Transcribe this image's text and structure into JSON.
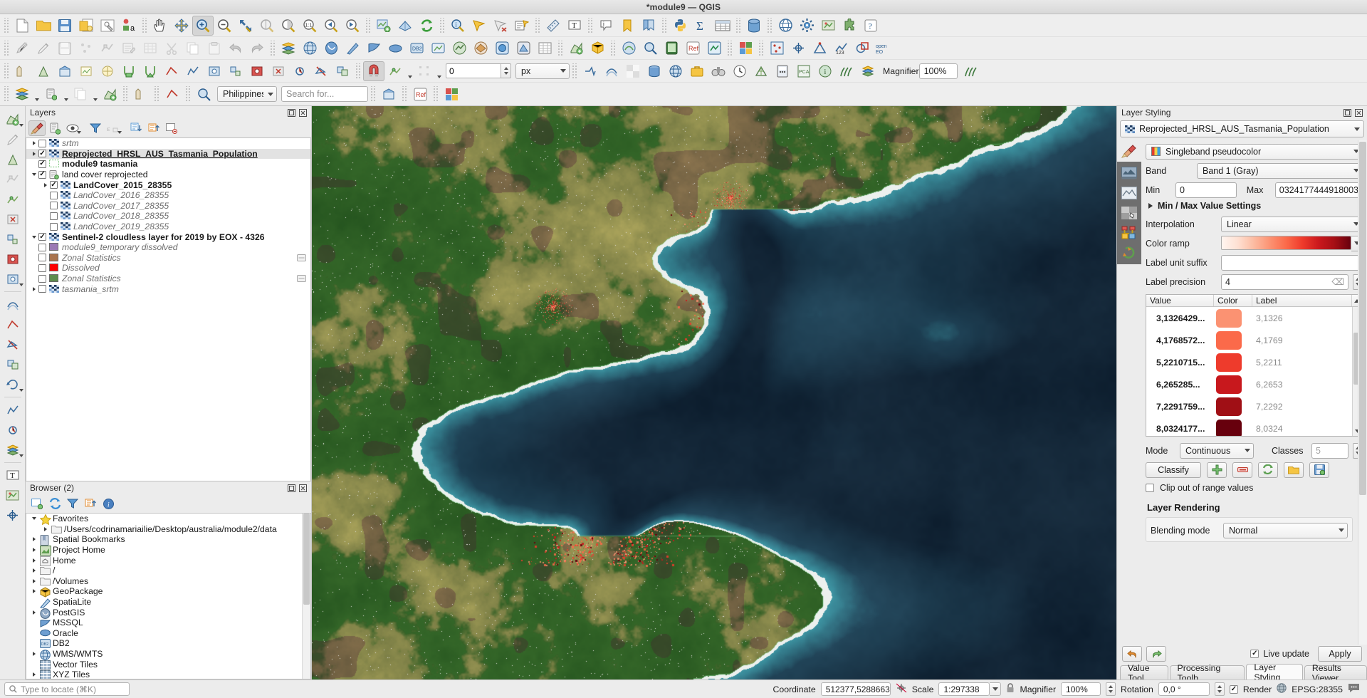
{
  "window": {
    "title": "*module9 — QGIS"
  },
  "toolbars": {
    "row1": [
      {
        "name": "new-project-icon",
        "icon": "page"
      },
      {
        "name": "open-project-icon",
        "icon": "folder"
      },
      {
        "name": "save-project-icon",
        "icon": "save"
      },
      {
        "name": "new-print-layout-icon",
        "icon": "layout"
      },
      {
        "name": "style-manager-icon",
        "icon": "stylemgr"
      },
      {
        "name": "layout-manager-icon",
        "icon": "dota"
      },
      {
        "sep": true
      },
      {
        "name": "pan-map-icon",
        "icon": "hand"
      },
      {
        "name": "pan-to-selection-icon",
        "icon": "panselect"
      },
      {
        "name": "zoom-in-icon",
        "icon": "zoomin",
        "selected": true
      },
      {
        "name": "zoom-out-icon",
        "icon": "zoomout"
      },
      {
        "name": "zoom-full-icon",
        "icon": "zoomfull"
      },
      {
        "name": "zoom-to-selection-icon",
        "icon": "zoomsel"
      },
      {
        "name": "zoom-to-layer-icon",
        "icon": "zoomlayer"
      },
      {
        "name": "zoom-native-icon",
        "icon": "zoom11"
      },
      {
        "name": "zoom-last-icon",
        "icon": "zoomback"
      },
      {
        "name": "zoom-next-icon",
        "icon": "zoomfwd"
      },
      {
        "sep": true
      },
      {
        "name": "new-map-view-icon",
        "icon": "newmapview"
      },
      {
        "name": "new-3d-map-view-icon",
        "icon": "map3d"
      },
      {
        "name": "refresh-icon",
        "icon": "refresh"
      },
      {
        "sep": true
      },
      {
        "name": "identify-features-icon",
        "icon": "identify"
      },
      {
        "name": "select-features-icon",
        "icon": "selectfeat"
      },
      {
        "name": "deselect-icon",
        "icon": "deselect"
      },
      {
        "name": "select-value-icon",
        "icon": "selectval"
      },
      {
        "sep": true
      },
      {
        "name": "measure-line-icon",
        "icon": "measure"
      },
      {
        "name": "text-annotation-icon",
        "icon": "textannot"
      },
      {
        "sep": true
      },
      {
        "name": "show-map-tips-icon",
        "icon": "maptips"
      },
      {
        "name": "bookmarks-icon",
        "icon": "bookmark"
      },
      {
        "name": "show-bookmarks-icon",
        "icon": "bookmarks2"
      },
      {
        "sep": true
      },
      {
        "name": "python-console-icon",
        "icon": "python"
      },
      {
        "name": "show-statistics-icon",
        "icon": "sumsigma"
      },
      {
        "name": "attribute-table-icon",
        "icon": "attrtable"
      },
      {
        "sep": true
      },
      {
        "name": "data-source-manager-icon",
        "icon": "database"
      },
      {
        "sep": true
      },
      {
        "name": "crs-status-icon",
        "icon": "globe"
      },
      {
        "name": "processing-toolbox-icon",
        "icon": "gears"
      },
      {
        "name": "georeferencer-icon",
        "icon": "georef"
      },
      {
        "name": "plugin-manager-icon",
        "icon": "plugin"
      },
      {
        "name": "help-icon",
        "icon": "help"
      }
    ],
    "row2": [
      {
        "name": "current-edits-icon",
        "icon": "pencil-multi"
      },
      {
        "name": "toggle-editing-icon",
        "icon": "pencil"
      },
      {
        "name": "save-layer-edits-icon",
        "icon": "savelayer"
      },
      {
        "name": "add-feature-icon",
        "icon": "addfeat"
      },
      {
        "name": "vertex-tool-icon",
        "icon": "vertex"
      },
      {
        "name": "modify-attributes-icon",
        "icon": "modattr"
      },
      {
        "name": "delete-selected-icon",
        "icon": "delsel"
      },
      {
        "name": "cut-features-icon",
        "icon": "cut"
      },
      {
        "name": "copy-features-icon",
        "icon": "copy"
      },
      {
        "name": "paste-features-icon",
        "icon": "paste"
      },
      {
        "name": "undo-icon",
        "icon": "undo"
      },
      {
        "name": "redo-icon",
        "icon": "redo"
      },
      {
        "sep": true
      },
      {
        "name": "open-data-source-manager-icon",
        "icon": "addlayer"
      },
      {
        "name": "add-wms-layer-icon",
        "icon": "wms"
      },
      {
        "name": "add-postgis-layer-icon",
        "icon": "postgis"
      },
      {
        "name": "add-spatialite-layer-icon",
        "icon": "spatialite"
      },
      {
        "name": "add-mssql-layer-icon",
        "icon": "mssql"
      },
      {
        "name": "add-oracle-layer-icon",
        "icon": "oracle"
      },
      {
        "name": "add-db2-layer-icon",
        "icon": "db2"
      },
      {
        "name": "add-virtual-layer-icon",
        "icon": "virtual"
      },
      {
        "name": "add-wcs-layer-icon",
        "icon": "wcs"
      },
      {
        "name": "add-wfs-layer-icon",
        "icon": "wfs"
      },
      {
        "name": "add-arcgis-map-icon",
        "icon": "arcgis"
      },
      {
        "name": "add-arcgis-feature-icon",
        "icon": "arcgis2"
      },
      {
        "name": "add-delimited-text-icon",
        "icon": "delim"
      },
      {
        "sep": true
      },
      {
        "name": "new-shapefile-icon",
        "icon": "newshape"
      },
      {
        "name": "new-geopackage-icon",
        "icon": "newgpkg"
      },
      {
        "sep": true
      },
      {
        "name": "openstreetmap-icon",
        "icon": "osm"
      },
      {
        "name": "metasearch-icon",
        "icon": "metasearch"
      },
      {
        "name": "qfield-icon",
        "icon": "qfield"
      },
      {
        "name": "inasafe-icon",
        "icon": "inasafe"
      },
      {
        "name": "sentinel-hub-icon",
        "icon": "sentinel"
      },
      {
        "sep": true
      },
      {
        "name": "semi-auto-classification-icon",
        "icon": "scp"
      },
      {
        "sep": true
      },
      {
        "name": "point-sampling-icon",
        "icon": "pointsample"
      },
      {
        "name": "coordinate-capture-icon",
        "icon": "coordcap"
      },
      {
        "name": "cad-tools-icon",
        "icon": "cadtools"
      },
      {
        "name": "numerical-vertex-icon",
        "icon": "numvertex"
      },
      {
        "name": "shape-tools-icon",
        "icon": "shapetools"
      },
      {
        "name": "open-layers-icon",
        "icon": "openlayers"
      }
    ],
    "row3_num": "0",
    "row3_unit": "px"
  },
  "search": {
    "region_value": "Philippines",
    "placeholder": "Search for..."
  },
  "layers_panel": {
    "title": "Layers",
    "tools": [
      "open-layer-styling-panel",
      "add-group",
      "manage-layer-visibility",
      "filter-legend",
      "filter-legend-expression",
      "expand-all",
      "collapse-all",
      "remove-layer"
    ],
    "items": [
      {
        "label": "srtm",
        "style": "italic",
        "checked": false,
        "expander": "collapsed",
        "indent": 0,
        "icon": "raster"
      },
      {
        "label": "Reprojected_HRSL_AUS_Tasmania_Population",
        "style": "bold-underline",
        "checked": true,
        "expander": "collapsed",
        "indent": 0,
        "icon": "raster",
        "selected": true
      },
      {
        "label": "module9 tasmania",
        "style": "bold",
        "checked": true,
        "expander": "none",
        "indent": 0,
        "icon": "polygon-outline"
      },
      {
        "label": "land cover reprojected",
        "style": "normal",
        "checked": true,
        "expander": "expanded",
        "indent": 0,
        "icon": "group"
      },
      {
        "label": "LandCover_2015_28355",
        "style": "bold",
        "checked": true,
        "expander": "collapsed",
        "indent": 1,
        "icon": "raster"
      },
      {
        "label": "LandCover_2016_28355",
        "style": "italic",
        "checked": false,
        "expander": "none",
        "indent": 1,
        "icon": "raster"
      },
      {
        "label": "LandCover_2017_28355",
        "style": "italic",
        "checked": false,
        "expander": "none",
        "indent": 1,
        "icon": "raster"
      },
      {
        "label": "LandCover_2018_28355",
        "style": "italic",
        "checked": false,
        "expander": "none",
        "indent": 1,
        "icon": "raster"
      },
      {
        "label": "LandCover_2019_28355",
        "style": "italic",
        "checked": false,
        "expander": "none",
        "indent": 1,
        "icon": "raster"
      },
      {
        "label": "Sentinel-2 cloudless layer for 2019 by EOX - 4326",
        "style": "bold",
        "checked": true,
        "expander": "expanded",
        "indent": 0,
        "icon": "raster"
      },
      {
        "label": "module9_temporary dissolved",
        "style": "italic",
        "checked": false,
        "expander": "none",
        "indent": 0,
        "icon": "swatch",
        "color": "#9b79b5"
      },
      {
        "label": "Zonal Statistics",
        "style": "italic",
        "checked": false,
        "expander": "none",
        "indent": 0,
        "icon": "swatch",
        "color": "#a9744e",
        "tail": "edit"
      },
      {
        "label": "Dissolved",
        "style": "italic",
        "checked": false,
        "expander": "none",
        "indent": 0,
        "icon": "swatch",
        "color": "#ff0000"
      },
      {
        "label": "Zonal Statistics",
        "style": "italic",
        "checked": false,
        "expander": "none",
        "indent": 0,
        "icon": "swatch",
        "color": "#5e8c4e",
        "tail": "edit"
      },
      {
        "label": "tasmania_srtm",
        "style": "italic",
        "checked": false,
        "expander": "collapsed",
        "indent": 0,
        "icon": "raster"
      }
    ]
  },
  "browser_panel": {
    "title": "Browser (2)",
    "tools": [
      "add-selected-layers",
      "refresh",
      "filter-browser",
      "collapse-all",
      "properties"
    ],
    "items": [
      {
        "label": "Favorites",
        "icon": "star",
        "expander": "expanded",
        "indent": 0
      },
      {
        "label": "/Users/codrinamariailie/Desktop/australia/module2/data",
        "icon": "folder",
        "expander": "collapsed",
        "indent": 1
      },
      {
        "label": "Spatial Bookmarks",
        "icon": "bookmark",
        "expander": "collapsed",
        "indent": 0
      },
      {
        "label": "Project Home",
        "icon": "projecthome",
        "expander": "collapsed",
        "indent": 0
      },
      {
        "label": "Home",
        "icon": "home",
        "expander": "collapsed",
        "indent": 0
      },
      {
        "label": "/",
        "icon": "folder",
        "expander": "collapsed",
        "indent": 0
      },
      {
        "label": "/Volumes",
        "icon": "folder",
        "expander": "collapsed",
        "indent": 0
      },
      {
        "label": "GeoPackage",
        "icon": "gpkg",
        "expander": "collapsed",
        "indent": 0
      },
      {
        "label": "SpatiaLite",
        "icon": "spatialite",
        "expander": "none",
        "indent": 0
      },
      {
        "label": "PostGIS",
        "icon": "postgis",
        "expander": "collapsed",
        "indent": 0
      },
      {
        "label": "MSSQL",
        "icon": "mssql",
        "expander": "none",
        "indent": 0
      },
      {
        "label": "Oracle",
        "icon": "oracle",
        "expander": "none",
        "indent": 0
      },
      {
        "label": "DB2",
        "icon": "db2",
        "expander": "none",
        "indent": 0
      },
      {
        "label": "WMS/WMTS",
        "icon": "wms",
        "expander": "collapsed",
        "indent": 0
      },
      {
        "label": "Vector Tiles",
        "icon": "tiles",
        "expander": "none",
        "indent": 0
      },
      {
        "label": "XYZ Tiles",
        "icon": "tiles",
        "expander": "collapsed",
        "indent": 0
      }
    ]
  },
  "layer_styling": {
    "title": "Layer Styling",
    "layer_name": "Reprojected_HRSL_AUS_Tasmania_Population",
    "renderer": "Singleband pseudocolor",
    "band_label": "Band",
    "band_value": "Band 1 (Gray)",
    "min_label": "Min",
    "min_value": "0",
    "max_label": "Max",
    "max_value": "0324177444918003",
    "minmax_settings_label": "Min / Max Value Settings",
    "interpolation_label": "Interpolation",
    "interpolation_value": "Linear",
    "colorramp_label": "Color ramp",
    "label_unit_suffix_label": "Label unit suffix",
    "label_unit_suffix_value": "",
    "label_precision_label": "Label precision",
    "label_precision_value": "4",
    "table": {
      "headers": [
        "Value",
        "Color",
        "Label"
      ],
      "rows": [
        {
          "value": "3,1326429...",
          "color": "#fb9272",
          "label": "3,1326"
        },
        {
          "value": "4,1768572...",
          "color": "#fb6a4a",
          "label": "4,1769"
        },
        {
          "value": "5,2210715...",
          "color": "#ee3b2c",
          "label": "5,2211"
        },
        {
          "value": "6,265285...",
          "color": "#c8181d",
          "label": "6,2653"
        },
        {
          "value": "7,2291759...",
          "color": "#a00f15",
          "label": "7,2292"
        },
        {
          "value": "8,0324177...",
          "color": "#67000d",
          "label": "8,0324"
        }
      ]
    },
    "mode_label": "Mode",
    "mode_value": "Continuous",
    "classes_label": "Classes",
    "classes_value": "5",
    "classify_label": "Classify",
    "classify_tools": [
      "add-entry",
      "delete-entry",
      "sort-entries",
      "load-colormap",
      "save-colormap"
    ],
    "clip_label": "Clip out of range values",
    "clip_checked": false,
    "layer_rendering_label": "Layer Rendering",
    "blending_label": "Blending mode",
    "blending_value": "Normal",
    "live_update_label": "Live update",
    "live_update_checked": true,
    "apply_label": "Apply",
    "undo_icon": "undo-style",
    "redo_icon": "redo-style"
  },
  "bottom_tabs": [
    {
      "label": "Value Tool",
      "active": false
    },
    {
      "label": "Processing Toolb...",
      "active": false
    },
    {
      "label": "Layer Styling",
      "active": true
    },
    {
      "label": "Results Viewer",
      "active": false
    }
  ],
  "statusbar": {
    "locate_placeholder": "Type to locate (⌘K)",
    "coordinate_label": "Coordinate",
    "coordinate_value": "512377,5288663",
    "scale_label": "Scale",
    "scale_value": "1:297338",
    "magnifier_label": "Magnifier",
    "magnifier_value": "100%",
    "rotation_label": "Rotation",
    "rotation_value": "0,0 °",
    "render_label": "Render",
    "render_checked": true,
    "crs_value": "EPSG:28355",
    "messages_icon": "messages-icon"
  },
  "colors": {
    "accent": "#cb181d",
    "panel_bg": "#ececec",
    "map_water": "#0e2636",
    "map_forest": "#1f5c22"
  }
}
